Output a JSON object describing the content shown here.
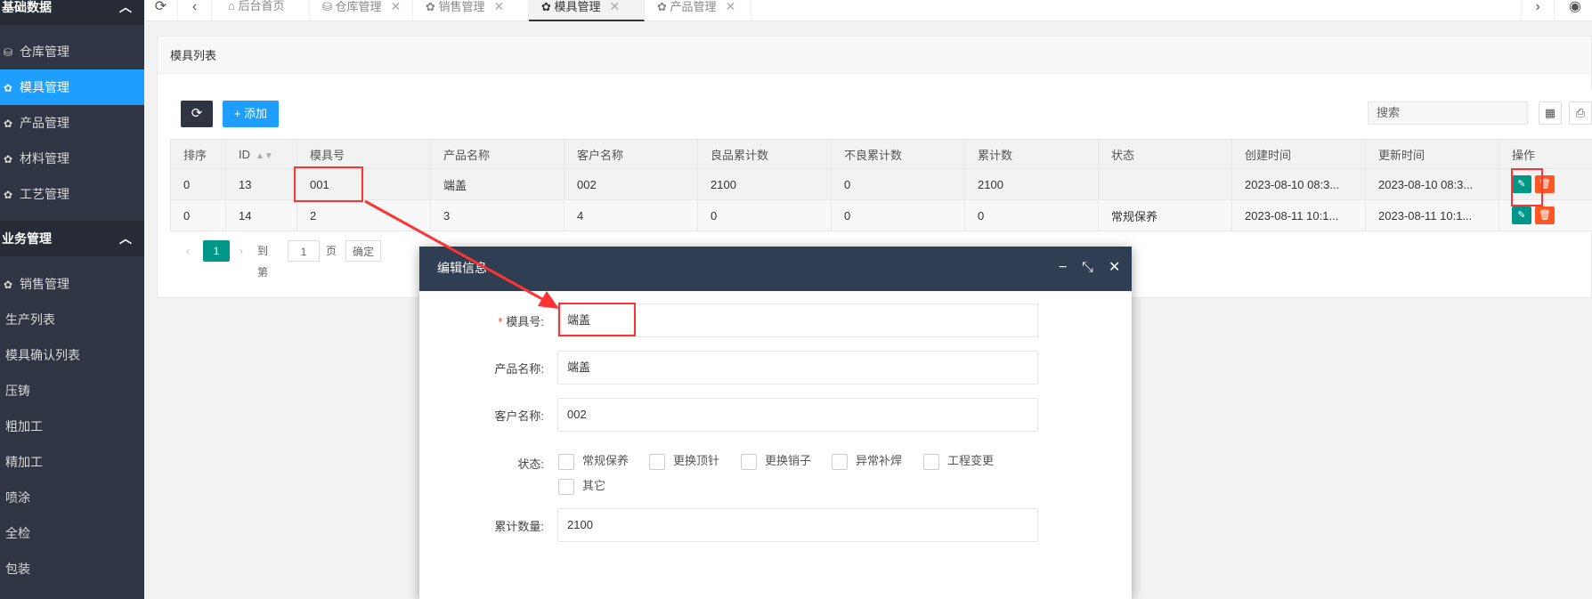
{
  "sidebar": {
    "group1": "基础数据",
    "group2": "业务管理",
    "items1": [
      {
        "label": "仓库管理",
        "icon": "database-icon",
        "glyph": "⛁"
      },
      {
        "label": "模具管理",
        "icon": "palette-icon",
        "glyph": "✿"
      },
      {
        "label": "产品管理",
        "icon": "palette-icon",
        "glyph": "✿"
      },
      {
        "label": "材料管理",
        "icon": "palette-icon",
        "glyph": "✿"
      },
      {
        "label": "工艺管理",
        "icon": "palette-icon",
        "glyph": "✿"
      }
    ],
    "items2": [
      {
        "label": "销售管理",
        "icon": "palette-icon",
        "glyph": "✿"
      },
      {
        "label": "生产列表"
      },
      {
        "label": "模具确认列表"
      },
      {
        "label": "压铸"
      },
      {
        "label": "粗加工"
      },
      {
        "label": "精加工"
      },
      {
        "label": "喷涂"
      },
      {
        "label": "全检"
      },
      {
        "label": "包装"
      }
    ]
  },
  "tabs": [
    {
      "label": "后台首页",
      "icon": "home-icon"
    },
    {
      "label": "仓库管理",
      "icon": "database-icon"
    },
    {
      "label": "销售管理",
      "icon": "palette-icon"
    },
    {
      "label": "模具管理",
      "icon": "palette-icon"
    },
    {
      "label": "产品管理",
      "icon": "palette-icon"
    }
  ],
  "card": {
    "title": "模具列表"
  },
  "toolbar": {
    "add_label": "+ 添加",
    "search_placeholder": "搜索"
  },
  "table": {
    "headers": [
      "排序",
      "ID",
      "模具号",
      "产品名称",
      "客户名称",
      "良品累计数",
      "不良累计数",
      "累计数",
      "状态",
      "创建时间",
      "更新时间",
      "操作"
    ],
    "rows": [
      [
        "0",
        "13",
        "001",
        "端盖",
        "002",
        "2100",
        "0",
        "2100",
        "",
        "2023-08-10 08:3...",
        "2023-08-10 08:3..."
      ],
      [
        "0",
        "14",
        "2",
        "3",
        "4",
        "0",
        "0",
        "0",
        "常规保养",
        "2023-08-11 10:1...",
        "2023-08-11 10:1..."
      ]
    ]
  },
  "pager": {
    "current": "1",
    "goto": "到第",
    "page_value": "1",
    "page_unit": "页",
    "confirm": "确定"
  },
  "dialog": {
    "title": "编辑信息",
    "fields": {
      "mold_no": {
        "label": "模具号:",
        "value": "端盖"
      },
      "product_name": {
        "label": "产品名称:",
        "value": "端盖"
      },
      "customer_name": {
        "label": "客户名称:",
        "value": "002"
      },
      "status_label": "状态:",
      "status_options": [
        "常规保养",
        "更换顶针",
        "更换销子",
        "异常补焊",
        "工程变更",
        "其它"
      ],
      "total_count": {
        "label": "累计数量:",
        "value": "2100"
      }
    }
  },
  "colors": {
    "sidebar": "#2f3542",
    "accent": "#1e9fff",
    "teal": "#009688",
    "danger": "#ff5722",
    "annotation": "#ff3333"
  }
}
